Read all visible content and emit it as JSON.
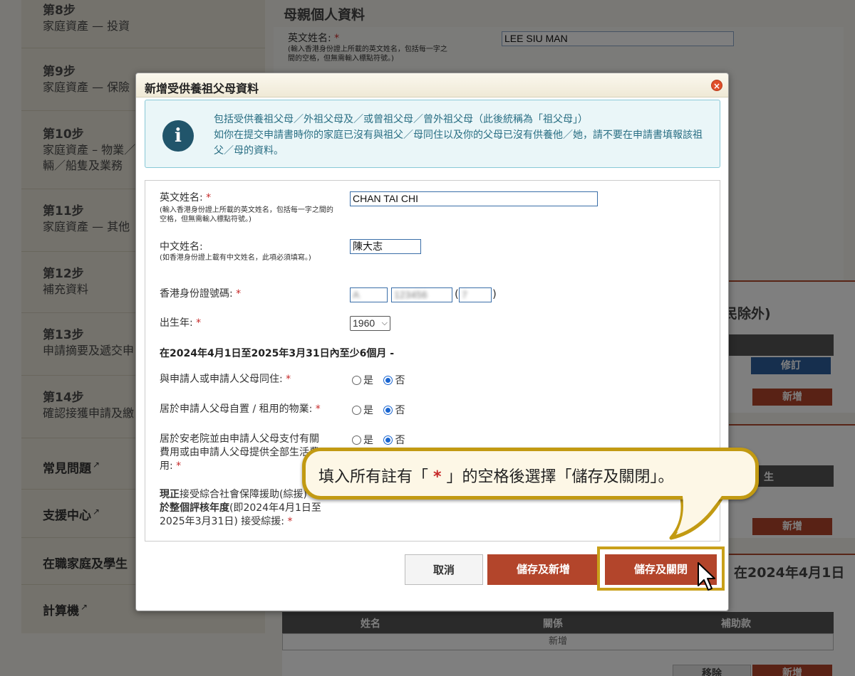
{
  "sidebar": {
    "steps": [
      {
        "num": "第8步",
        "title": "家庭資產 — 投資"
      },
      {
        "num": "第9步",
        "title": "家庭資產 — 保險"
      },
      {
        "num": "第10步",
        "title": "家庭資產 – 物業／",
        "title2": "輛／船隻及業務"
      },
      {
        "num": "第11步",
        "title": "家庭資產 — 其他"
      },
      {
        "num": "第12步",
        "title": "補充資料"
      },
      {
        "num": "第13步",
        "title": "申請摘要及遞交申"
      },
      {
        "num": "第14步",
        "title": "確認接獲申請及繳"
      }
    ],
    "links": [
      "常見問題",
      "支援中心",
      "在職家庭及學生",
      "計算機"
    ]
  },
  "background": {
    "mother_heading": "母親個人資料",
    "mother_name_label": "英文姓名:",
    "mother_name_note": "(輸入香港身份證上所載的英文姓名，包括每一字之間的空格，但無需輸入標點符號。)",
    "mother_name_value": "LEE SIU MAN",
    "section_heading_fragment": "民除外)",
    "edit_label": "修訂",
    "add_label": "新增",
    "table_col_fragment": "生",
    "date_heading_fragment": "在2024年4月1日",
    "table_headers": [
      "姓名",
      "關係",
      "補助款"
    ],
    "table_add_row": "新增",
    "remove_label": "移除"
  },
  "dialog": {
    "title": "新增受供養祖父母資料",
    "info_line1": "包括受供養祖父母／外祖父母及／或曾祖父母／曾外祖父母（此後統稱為「祖父母」）",
    "info_line2": "如你在提交申請書時你的家庭已沒有與祖父／母同住以及你的父母已沒有供養他／她，請不要在申請書填報該祖父／母的資料。",
    "fields": {
      "english_name_label": "英文姓名:",
      "english_name_note": "(輸入香港身份證上所載的英文姓名，包括每一字之間的空格，但無需輸入標點符號。)",
      "english_name_value": "CHAN TAI CHI",
      "chinese_name_label": "中文姓名:",
      "chinese_name_note": "(如香港身份證上載有中文姓名，此項必須填寫。)",
      "chinese_name_value": "陳大志",
      "hkid_label": "香港身份證號碼:",
      "hkid_part1": "A",
      "hkid_part2": "123456",
      "hkid_check": "7",
      "birth_year_label": "出生年:",
      "birth_year_value": "1960",
      "period_heading": "在2024年4月1日至2025年3月31日內至少6個月 -",
      "q1_label": "與申請人或申請人父母同住:",
      "q2_label": "居於申請人父母自置 / 租用的物業:",
      "q3_line1": "居於安老院並由申請人父母支付有關",
      "q3_line2": "費用或由申請人父母提供全部生活費",
      "q3_line3": "用:",
      "q4_line1_bold": "現正",
      "q4_line1_rest": "接受綜合社會保障援助(綜援)",
      "q4_line2_bold": "於整個評核年度",
      "q4_line2_rest": "(即2024年4月1日至",
      "q4_line3": "2025年3月31日) 接受綜援:",
      "yes": "是",
      "no": "否",
      "required_mark": "*"
    },
    "buttons": {
      "cancel": "取消",
      "save_new": "儲存及新增",
      "save_close": "儲存及關閉"
    }
  },
  "callout": {
    "text_before": "填入所有註有「",
    "star": "*",
    "text_after": "」的空格後選擇「儲存及關閉」。"
  },
  "colors": {
    "primary_red": "#b3452b",
    "callout_gold": "#c29a12",
    "info_teal": "#2a6f84"
  }
}
